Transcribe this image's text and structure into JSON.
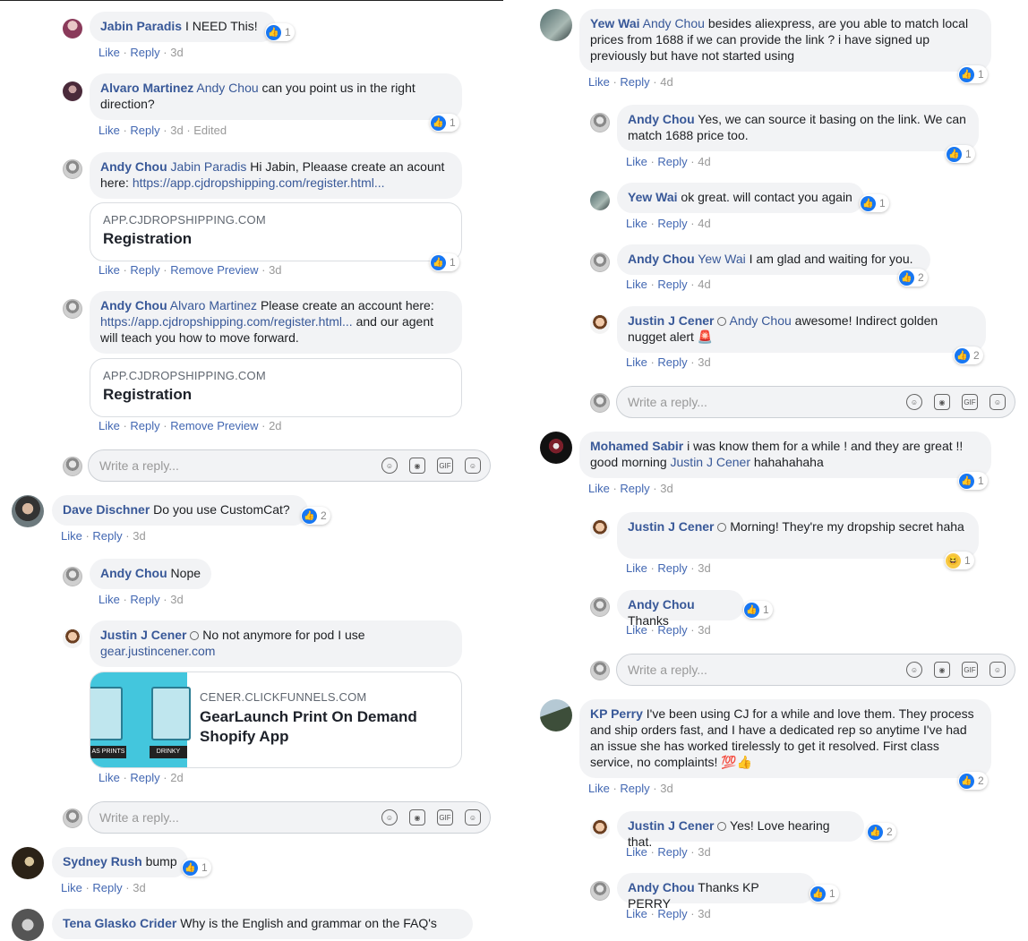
{
  "left": {
    "c1": {
      "name": "Jabin Paradis",
      "text": "I NEED This!",
      "react": "1",
      "like": "Like",
      "reply": "Reply",
      "time": "3d"
    },
    "c2": {
      "name": "Alvaro Martinez",
      "mention": "Andy Chou",
      "text": "can you point us in the right direction?",
      "react": "1",
      "like": "Like",
      "reply": "Reply",
      "time": "3d",
      "edited": "Edited"
    },
    "c3": {
      "name": "Andy Chou",
      "mention": "Jabin Paradis",
      "text": "Hi Jabin, Pleaase create an acount here:",
      "link": "https://app.cjdropshipping.com/register.html...",
      "pv_domain": "APP.CJDROPSHIPPING.COM",
      "pv_title": "Registration",
      "react": "1",
      "like": "Like",
      "reply": "Reply",
      "remove": "Remove Preview",
      "time": "3d"
    },
    "c4": {
      "name": "Andy Chou",
      "mention": "Alvaro Martinez",
      "text1": "Please create an account here:",
      "link": "https://app.cjdropshipping.com/register.html...",
      "text2": "and our agent will teach you how to move forward.",
      "pv_domain": "APP.CJDROPSHIPPING.COM",
      "pv_title": "Registration",
      "like": "Like",
      "reply": "Reply",
      "remove": "Remove Preview",
      "time": "2d"
    },
    "reply_placeholder": "Write a reply...",
    "c5": {
      "name": "Dave Dischner",
      "text": "Do you use CustomCat?",
      "react": "2",
      "like": "Like",
      "reply": "Reply",
      "time": "3d"
    },
    "c6": {
      "name": "Andy Chou",
      "text": "Nope",
      "like": "Like",
      "reply": "Reply",
      "time": "3d"
    },
    "c7": {
      "name": "Justin J Cener",
      "text": "No not anymore for pod I use",
      "link": "gear.justincener.com",
      "pv_domain": "CENER.CLICKFUNNELS.COM",
      "pv_title": "GearLaunch Print On Demand Shopify App",
      "img_left": "AS PRINTS",
      "img_right": "DRINKY",
      "like": "Like",
      "reply": "Reply",
      "time": "2d"
    },
    "c8": {
      "name": "Sydney Rush",
      "text": "bump",
      "react": "1",
      "like": "Like",
      "reply": "Reply",
      "time": "3d"
    },
    "c9": {
      "name": "Tena Glasko Crider",
      "text": "Why is the English and grammar on the FAQ's"
    }
  },
  "right": {
    "r1": {
      "name": "Yew Wai",
      "mention": "Andy Chou",
      "text": "besides aliexpress, are you able to match local prices from 1688 if we can provide the link ? i have signed up previously but have not started using",
      "react": "1",
      "like": "Like",
      "reply": "Reply",
      "time": "4d"
    },
    "r2": {
      "name": "Andy Chou",
      "text": "Yes, we can source it basing on the link. We can match 1688 price too.",
      "react": "1",
      "like": "Like",
      "reply": "Reply",
      "time": "4d"
    },
    "r3": {
      "name": "Yew Wai",
      "text": "ok great. will contact you again",
      "react": "1",
      "like": "Like",
      "reply": "Reply",
      "time": "4d"
    },
    "r4": {
      "name": "Andy Chou",
      "mention": "Yew Wai",
      "text": "I am glad and waiting for you.",
      "react": "2",
      "like": "Like",
      "reply": "Reply",
      "time": "4d"
    },
    "r5": {
      "name": "Justin J Cener",
      "mention": "Andy Chou",
      "text": "awesome! Indirect golden nugget alert",
      "emoji": "🚨",
      "react": "2",
      "like": "Like",
      "reply": "Reply",
      "time": "3d"
    },
    "reply_placeholder": "Write a reply...",
    "r6": {
      "name": "Mohamed Sabir",
      "text1": "i was know them for a while ! and they are great !! good morning",
      "mention": "Justin J Cener",
      "text2": "hahahahaha",
      "react": "1",
      "like": "Like",
      "reply": "Reply",
      "time": "3d"
    },
    "r7": {
      "name": "Justin J Cener",
      "text": "Morning! They're my dropship secret haha",
      "react": "1",
      "like": "Like",
      "reply": "Reply",
      "time": "3d"
    },
    "r8": {
      "name": "Andy Chou",
      "text": "Thanks",
      "react": "1",
      "like": "Like",
      "reply": "Reply",
      "time": "3d"
    },
    "r9": {
      "name": "KP Perry",
      "text": "I've been using CJ for a while and love them. They process and ship orders fast, and I have a dedicated rep so anytime I've had an issue she has worked tirelessly to get it resolved. First class service, no complaints!",
      "emoji": "💯👍",
      "react": "2",
      "like": "Like",
      "reply": "Reply",
      "time": "3d"
    },
    "r10": {
      "name": "Justin J Cener",
      "text": "Yes! Love hearing that.",
      "react": "2",
      "like": "Like",
      "reply": "Reply",
      "time": "3d"
    },
    "r11": {
      "name": "Andy Chou",
      "text": "Thanks KP PERRY",
      "react": "1",
      "like": "Like",
      "reply": "Reply",
      "time": "3d"
    }
  },
  "icons": {
    "like": "like-icon",
    "haha": "haha-icon",
    "emoji": "emoji-icon",
    "camera": "camera-icon",
    "gif": "gif-icon",
    "sticker": "sticker-icon"
  },
  "colors": {
    "link": "#385898",
    "like_blue": "#1877f2",
    "bubble": "#f2f3f5"
  }
}
